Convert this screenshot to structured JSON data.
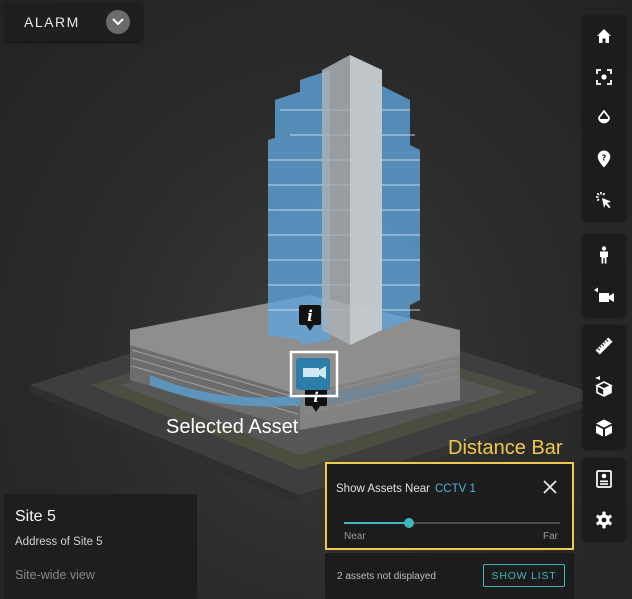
{
  "alarm": {
    "label": "ALARM"
  },
  "annotations": {
    "selected_asset": "Selected Asset",
    "distance_bar": "Distance Bar"
  },
  "site": {
    "title": "Site 5",
    "address": "Address of Site 5",
    "view_link": "Site-wide view"
  },
  "distance": {
    "prefix": "Show Assets Near",
    "asset": "CCTV 1",
    "near_label": "Near",
    "far_label": "Far",
    "slider_value_fraction": 0.3
  },
  "footer": {
    "not_displayed": "2 assets not displayed",
    "show_list": "SHOW LIST"
  },
  "toolbar_icons": {
    "group1": [
      "home-icon",
      "focus-icon",
      "drop-icon",
      "help-pin-icon",
      "select-cursor-icon"
    ],
    "group2": [
      "person-icon",
      "camera-icon"
    ],
    "group3": [
      "ruler-icon",
      "box-section-icon",
      "cube-icon"
    ],
    "group4": [
      "panel-icon",
      "gear-icon"
    ]
  },
  "colors": {
    "accent": "#3fb7bd",
    "highlight": "#f2c94c",
    "link": "#4fb3d9"
  }
}
